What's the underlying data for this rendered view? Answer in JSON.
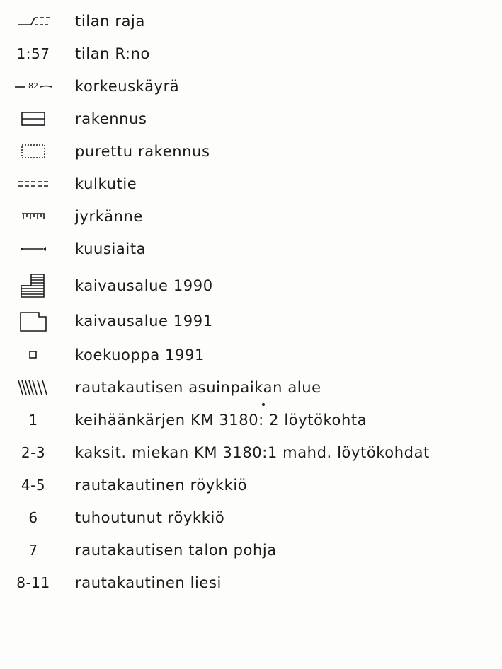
{
  "legend": {
    "items": [
      {
        "symbol": "property-boundary-icon",
        "label": "tilan raja"
      },
      {
        "code": "1:57",
        "label": "tilan R:no"
      },
      {
        "symbol": "contour-line-icon",
        "code": "82",
        "label": "korkeuskäyrä"
      },
      {
        "symbol": "building-icon",
        "label": "rakennus"
      },
      {
        "symbol": "demolished-building-icon",
        "label": "purettu rakennus"
      },
      {
        "symbol": "path-icon",
        "label": "kulkutie"
      },
      {
        "symbol": "escarpment-icon",
        "label": "jyrkänne"
      },
      {
        "symbol": "spruce-hedge-icon",
        "label": "kuusiaita"
      },
      {
        "symbol": "excavation-area-1990-icon",
        "label": "kaivausalue 1990"
      },
      {
        "symbol": "excavation-area-1991-icon",
        "label": "kaivausalue 1991"
      },
      {
        "symbol": "test-pit-icon",
        "label": "koekuoppa 1991"
      },
      {
        "symbol": "settlement-area-hatch-icon",
        "label": "rautakautisen asuinpaikan alue"
      },
      {
        "code": "1",
        "label": "keihäänkärjen KM 3180: 2  löytökohta"
      },
      {
        "code": "2-3",
        "label": "kaksit. miekan KM 3180:1  mahd. löytökohdat"
      },
      {
        "code": "4-5",
        "label": "rautakautinen röykkiö"
      },
      {
        "code": "6",
        "label": "tuhoutunut röykkiö"
      },
      {
        "code": "7",
        "label": "rautakautisen talon pohja"
      },
      {
        "code": "8-11",
        "label": "rautakautinen liesi"
      }
    ]
  }
}
